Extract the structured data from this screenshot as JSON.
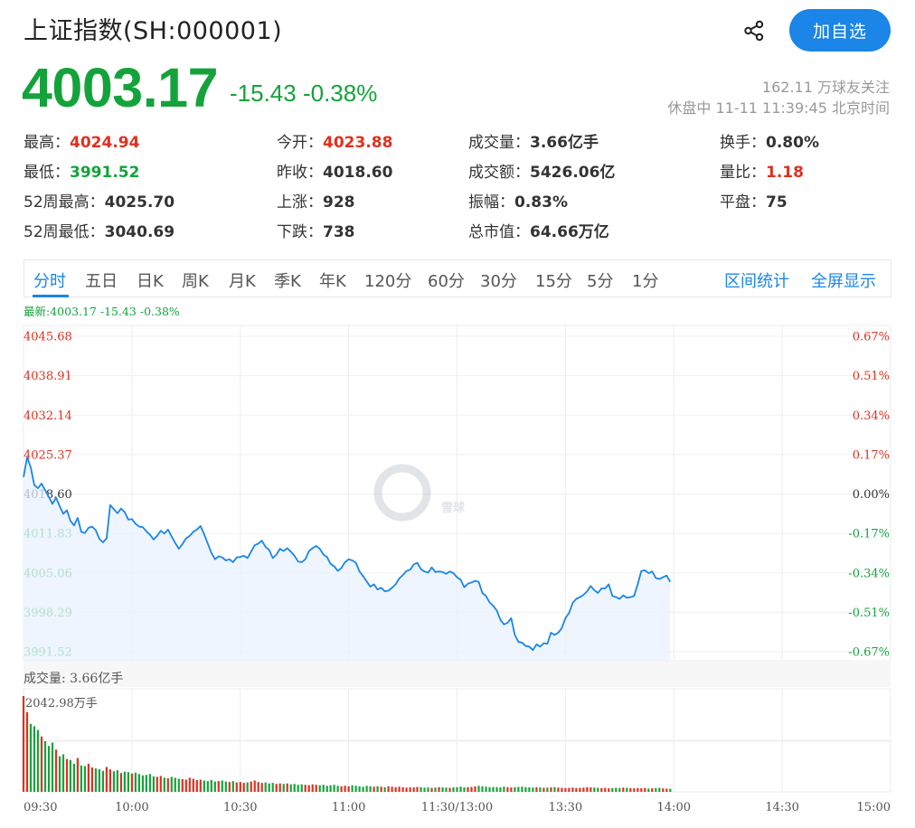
{
  "header": {
    "title": "上证指数(SH:000001)",
    "add_button": "加自选",
    "share_icon": "share-icon"
  },
  "quote": {
    "price": "4003.17",
    "change": "-15.43 -0.38%",
    "followers": "162.11 万球友关注",
    "trade_status": "休盘中 11-11 11:39:45 北京时间",
    "colors": {
      "up": "#e0301e",
      "down": "#14a33b",
      "accent": "#1b85e8"
    }
  },
  "stats": [
    [
      {
        "label": "最高：",
        "value": "4024.94",
        "color": "red"
      },
      {
        "label": "今开：",
        "value": "4023.88",
        "color": "red"
      },
      {
        "label": "成交量：",
        "value": "3.66亿手",
        "color": ""
      },
      {
        "label": "换手：",
        "value": "0.80%",
        "color": ""
      }
    ],
    [
      {
        "label": "最低：",
        "value": "3991.52",
        "color": "green"
      },
      {
        "label": "昨收：",
        "value": "4018.60",
        "color": ""
      },
      {
        "label": "成交额：",
        "value": "5426.06亿",
        "color": ""
      },
      {
        "label": "量比：",
        "value": "1.18",
        "color": "red"
      }
    ],
    [
      {
        "label": "52周最高：",
        "value": "4025.70",
        "color": ""
      },
      {
        "label": "上涨：",
        "value": "928",
        "color": ""
      },
      {
        "label": "振幅：",
        "value": "0.83%",
        "color": ""
      },
      {
        "label": "平盘：",
        "value": "75",
        "color": ""
      }
    ],
    [
      {
        "label": "52周最低：",
        "value": "3040.69",
        "color": ""
      },
      {
        "label": "下跌：",
        "value": "738",
        "color": ""
      },
      {
        "label": "总市值：",
        "value": "64.66万亿",
        "color": ""
      }
    ]
  ],
  "tabs": [
    "分时",
    "五日",
    "日K",
    "周K",
    "月K",
    "季K",
    "年K",
    "120分",
    "60分",
    "30分",
    "15分",
    "5分",
    "1分"
  ],
  "active_tab": 0,
  "tab_links": [
    "区间统计",
    "全屏显示"
  ],
  "chart": {
    "latest_label": "最新:4003.17 -15.43 -0.38%",
    "watermark": "雪球",
    "volume_label": "成交量: 3.66亿手",
    "volume_max_label": "2042.98万手"
  },
  "chart_data": {
    "type": "line",
    "prev_close": 4018.6,
    "ylim": [
      3991.52,
      4045.68
    ],
    "y_ticks_left": [
      "4045.68",
      "4038.91",
      "4032.14",
      "4025.37",
      "4018.60",
      "4011.83",
      "4005.06",
      "3998.29",
      "3991.52"
    ],
    "y_ticks_right": [
      "0.67%",
      "0.51%",
      "0.34%",
      "0.17%",
      "0.00%",
      "-0.17%",
      "-0.34%",
      "-0.51%",
      "-0.67%"
    ],
    "x_ticks": [
      "09:30",
      "10:00",
      "10:30",
      "11:00",
      "11:30/13:00",
      "13:30",
      "14:00",
      "14:30",
      "15:00"
    ],
    "total_minutes": 240,
    "prices": [
      4021.5,
      4024.9,
      4023.2,
      4020.1,
      4019.6,
      4020.4,
      4019.2,
      4018.1,
      4016.9,
      4018.0,
      4016.5,
      4015.2,
      4015.8,
      4014.0,
      4013.2,
      4014.5,
      4012.1,
      4011.9,
      4012.8,
      4013.0,
      4012.4,
      4010.9,
      4010.3,
      4011.0,
      4016.7,
      4016.0,
      4015.3,
      4016.1,
      4015.5,
      4014.2,
      4014.3,
      4013.5,
      4013.0,
      4012.9,
      4012.2,
      4011.6,
      4010.8,
      4011.4,
      4012.3,
      4011.8,
      4012.5,
      4011.3,
      4010.2,
      4009.2,
      4010.0,
      4011.0,
      4011.4,
      4012.1,
      4012.5,
      4013.1,
      4011.7,
      4010.1,
      4008.5,
      4007.4,
      4007.9,
      4007.7,
      4007.2,
      4007.4,
      4006.9,
      4007.7,
      4007.8,
      4008.0,
      4007.6,
      4008.7,
      4009.8,
      4010.1,
      4010.6,
      4009.5,
      4009.0,
      4007.6,
      4008.2,
      4009.2,
      4008.8,
      4009.3,
      4008.7,
      4008.0,
      4007.0,
      4006.9,
      4007.4,
      4008.8,
      4009.3,
      4009.7,
      4009.2,
      4008.2,
      4007.8,
      4006.6,
      4006.2,
      4005.4,
      4005.9,
      4006.9,
      4007.4,
      4007.2,
      4006.8,
      4005.3,
      4004.5,
      4003.6,
      4002.7,
      4003.1,
      4002.2,
      4002.5,
      4001.9,
      4002.0,
      4002.5,
      4003.1,
      4004.1,
      4004.7,
      4005.4,
      4005.6,
      4006.5,
      4006.8,
      4005.7,
      4005.3,
      4005.1,
      4006.0,
      4005.2,
      4005.3,
      4005.2,
      4004.9,
      4005.3,
      4005.0,
      4004.3,
      4003.9,
      4002.6,
      4003.2,
      4003.4,
      4003.7,
      4003.5,
      4001.6,
      4001.1,
      4000.0,
      3999.4,
      3998.6,
      3997.0,
      3996.2,
      3996.5,
      3997.3,
      3994.4,
      3993.2,
      3993.1,
      3992.5,
      3992.4,
      3991.8,
      3992.8,
      3992.4,
      3993.0,
      3992.9,
      3994.8,
      3994.4,
      3994.8,
      3995.6,
      3997.3,
      3998.2,
      3999.9,
      4000.6,
      4000.9,
      4001.3,
      4001.9,
      4002.8,
      4002.1,
      4001.6,
      4002.4,
      4002.4,
      4003.1,
      4001.1,
      4000.9,
      4000.6,
      4001.2,
      4000.8,
      4000.9,
      4001.1,
      4003.1,
      4005.4,
      4005.5,
      4005.0,
      4005.3,
      4004.2,
      4004.0,
      4004.3,
      4004.6,
      4003.5
    ],
    "volumes": [
      2042.98,
      1700,
      1450,
      1400,
      1320,
      1180,
      1080,
      980,
      1050,
      900,
      760,
      800,
      700,
      680,
      600,
      720,
      560,
      550,
      600,
      520,
      500,
      480,
      450,
      530,
      480,
      440,
      460,
      400,
      430,
      420,
      390,
      410,
      380,
      350,
      360,
      380,
      330,
      320,
      340,
      300,
      290,
      320,
      300,
      280,
      270,
      260,
      300,
      280,
      250,
      260,
      240,
      230,
      250,
      220,
      230,
      240,
      220,
      210,
      230,
      200,
      210,
      190,
      200,
      220,
      240,
      210,
      190,
      200,
      180,
      190,
      170,
      180,
      170,
      180,
      160,
      170,
      150,
      160,
      150,
      140,
      160,
      150,
      140,
      150,
      130,
      140,
      150,
      130,
      120,
      130,
      120,
      140,
      130,
      120,
      110,
      130,
      120,
      110,
      120,
      110,
      100,
      120,
      110,
      100,
      110,
      100,
      90,
      100,
      95,
      105,
      100,
      90,
      95,
      85,
      90,
      100,
      95,
      90,
      85,
      95,
      100,
      110,
      95,
      100,
      105,
      115,
      130,
      120,
      110,
      100,
      105,
      100,
      95,
      110,
      100,
      95,
      100,
      105,
      110,
      100,
      95,
      90,
      100,
      95,
      85,
      90,
      95,
      100,
      90,
      85,
      80,
      85,
      90,
      80,
      85,
      90,
      100,
      95,
      90,
      85,
      80,
      85,
      75,
      80,
      85,
      80,
      90,
      85,
      80,
      75,
      80,
      75,
      80,
      70,
      75,
      80,
      85,
      75,
      70,
      65
    ],
    "volume_max": 2042.98
  }
}
